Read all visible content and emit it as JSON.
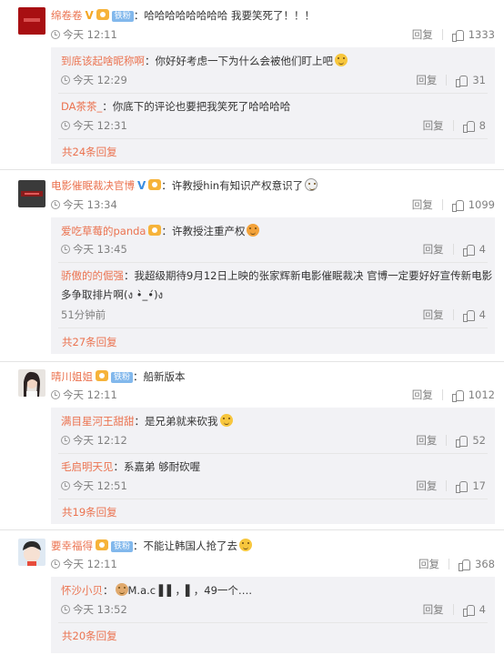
{
  "comments": [
    {
      "user": "绵卷卷",
      "text": "哈哈哈哈哈哈哈哈 我要笑死了！！！",
      "time": "今天 12:11",
      "reply_label": "回复",
      "likes": "1333",
      "fan_badge": "铁粉",
      "replies": [
        {
          "user": "到底该起啥昵称啊",
          "text": "你好好考虑一下为什么会被他们盯上吧",
          "time": "今天 12:29",
          "reply_label": "回复",
          "likes": "31"
        },
        {
          "user": "DA茶茶_",
          "text": "你底下的评论也要把我笑死了哈哈哈哈",
          "time": "今天 12:31",
          "reply_label": "回复",
          "likes": "8"
        }
      ],
      "more": "共24条回复"
    },
    {
      "user": "电影催眠裁决官博",
      "text": "许教授hin有知识产权意识了",
      "time": "今天 13:34",
      "reply_label": "回复",
      "likes": "1099",
      "replies": [
        {
          "user": "爱吃草莓的panda",
          "text": "许教授注重产权",
          "time": "今天 13:45",
          "reply_label": "回复",
          "likes": "4"
        },
        {
          "user": "骄傲的的倔强",
          "text": "我超级期待9月12日上映的张家辉新电影催眠裁决 官博一定要好好宣传新电影",
          "text2": "多争取排片啊(ง •̀_•́)ง",
          "time": "51分钟前",
          "reply_label": "回复",
          "likes": "4"
        }
      ],
      "more": "共27条回复"
    },
    {
      "user": "晴川姐姐",
      "text": "船新版本",
      "time": "今天 12:11",
      "reply_label": "回复",
      "likes": "1012",
      "fan_badge": "铁粉",
      "replies": [
        {
          "user": "满目星河王甜甜",
          "text": "是兄弟就来砍我",
          "time": "今天 12:12",
          "reply_label": "回复",
          "likes": "52"
        },
        {
          "user": "毛启明天见",
          "text": "系嘉弟 够耐砍喔",
          "time": "今天 12:51",
          "reply_label": "回复",
          "likes": "17"
        }
      ],
      "more": "共19条回复"
    },
    {
      "user": "要幸福得",
      "text": "不能让韩国人抢了去",
      "time": "今天 12:11",
      "reply_label": "回复",
      "likes": "368",
      "fan_badge": "铁粉",
      "replies": [
        {
          "user": "怀沙小贝",
          "text": "M.a.c ▌▌，▌，49一个….",
          "time": "今天 13:52",
          "reply_label": "回复",
          "likes": "4"
        }
      ],
      "more": "共20条回复"
    }
  ],
  "colors": {
    "name": "#eb7350",
    "reply_bg": "#f2f2f5",
    "muted": "#808080"
  }
}
